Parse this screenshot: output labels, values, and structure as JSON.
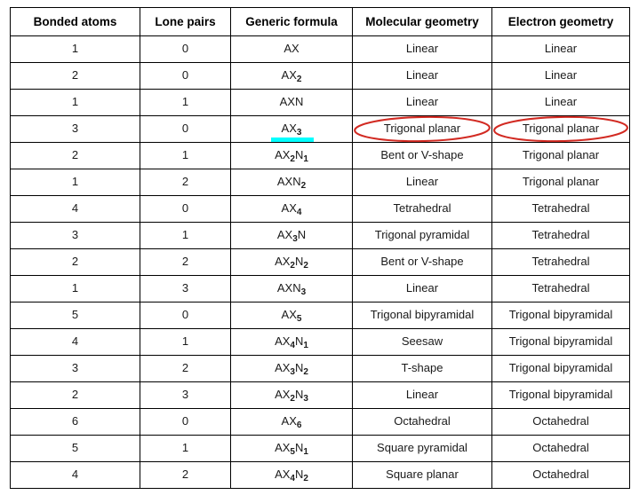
{
  "table": {
    "headers": [
      "Bonded atoms",
      "Lone pairs",
      "Generic formula",
      "Molecular geometry",
      "Electron geometry"
    ],
    "rows": [
      {
        "bonded_atoms": "1",
        "lone_pairs": "0",
        "formula_base": "AX",
        "formula_sub1": "",
        "formula_mid": "",
        "formula_sub2": "",
        "formula_plain": "AX",
        "molecular_geometry": "Linear",
        "electron_geometry": "Linear"
      },
      {
        "bonded_atoms": "2",
        "lone_pairs": "0",
        "formula_base": "AX",
        "formula_sub1": "2",
        "formula_mid": "",
        "formula_sub2": "",
        "formula_plain": "AX2",
        "molecular_geometry": "Linear",
        "electron_geometry": "Linear"
      },
      {
        "bonded_atoms": "1",
        "lone_pairs": "1",
        "formula_base": "AX",
        "formula_sub1": "",
        "formula_mid": "N",
        "formula_sub2": "",
        "formula_plain": "AXN",
        "molecular_geometry": "Linear",
        "electron_geometry": "Linear"
      },
      {
        "bonded_atoms": "3",
        "lone_pairs": "0",
        "formula_base": "AX",
        "formula_sub1": "3",
        "formula_mid": "",
        "formula_sub2": "",
        "formula_plain": "AX3",
        "molecular_geometry": "Trigonal planar",
        "electron_geometry": "Trigonal planar"
      },
      {
        "bonded_atoms": "2",
        "lone_pairs": "1",
        "formula_base": "AX",
        "formula_sub1": "2",
        "formula_mid": "N",
        "formula_sub2": "1",
        "formula_plain": "AX2N1",
        "molecular_geometry": "Bent or V-shape",
        "electron_geometry": "Trigonal planar"
      },
      {
        "bonded_atoms": "1",
        "lone_pairs": "2",
        "formula_base": "AX",
        "formula_sub1": "",
        "formula_mid": "N",
        "formula_sub2": "2",
        "formula_plain": "AXN2",
        "molecular_geometry": "Linear",
        "electron_geometry": "Trigonal planar"
      },
      {
        "bonded_atoms": "4",
        "lone_pairs": "0",
        "formula_base": "AX",
        "formula_sub1": "4",
        "formula_mid": "",
        "formula_sub2": "",
        "formula_plain": "AX4",
        "molecular_geometry": "Tetrahedral",
        "electron_geometry": "Tetrahedral"
      },
      {
        "bonded_atoms": "3",
        "lone_pairs": "1",
        "formula_base": "AX",
        "formula_sub1": "3",
        "formula_mid": "N",
        "formula_sub2": "",
        "formula_plain": "AX3N",
        "molecular_geometry": "Trigonal pyramidal",
        "electron_geometry": "Tetrahedral"
      },
      {
        "bonded_atoms": "2",
        "lone_pairs": "2",
        "formula_base": "AX",
        "formula_sub1": "2",
        "formula_mid": "N",
        "formula_sub2": "2",
        "formula_plain": "AX2N2",
        "molecular_geometry": "Bent or V-shape",
        "electron_geometry": "Tetrahedral"
      },
      {
        "bonded_atoms": "1",
        "lone_pairs": "3",
        "formula_base": "AX",
        "formula_sub1": "",
        "formula_mid": "N",
        "formula_sub2": "3",
        "formula_plain": "AXN3",
        "molecular_geometry": "Linear",
        "electron_geometry": "Tetrahedral"
      },
      {
        "bonded_atoms": "5",
        "lone_pairs": "0",
        "formula_base": "AX",
        "formula_sub1": "5",
        "formula_mid": "",
        "formula_sub2": "",
        "formula_plain": "AX5",
        "molecular_geometry": "Trigonal bipyramidal",
        "electron_geometry": "Trigonal bipyramidal"
      },
      {
        "bonded_atoms": "4",
        "lone_pairs": "1",
        "formula_base": "AX",
        "formula_sub1": "4",
        "formula_mid": "N",
        "formula_sub2": "1",
        "formula_plain": "AX4N1",
        "molecular_geometry": "Seesaw",
        "electron_geometry": "Trigonal bipyramidal"
      },
      {
        "bonded_atoms": "3",
        "lone_pairs": "2",
        "formula_base": "AX",
        "formula_sub1": "3",
        "formula_mid": "N",
        "formula_sub2": "2",
        "formula_plain": "AX3N2",
        "molecular_geometry": "T-shape",
        "electron_geometry": "Trigonal bipyramidal"
      },
      {
        "bonded_atoms": "2",
        "lone_pairs": "3",
        "formula_base": "AX",
        "formula_sub1": "2",
        "formula_mid": "N",
        "formula_sub2": "3",
        "formula_plain": "AX2N3",
        "molecular_geometry": "Linear",
        "electron_geometry": "Trigonal bipyramidal"
      },
      {
        "bonded_atoms": "6",
        "lone_pairs": "0",
        "formula_base": "AX",
        "formula_sub1": "6",
        "formula_mid": "",
        "formula_sub2": "",
        "formula_plain": "AX6",
        "molecular_geometry": "Octahedral",
        "electron_geometry": "Octahedral"
      },
      {
        "bonded_atoms": "5",
        "lone_pairs": "1",
        "formula_base": "AX",
        "formula_sub1": "5",
        "formula_mid": "N",
        "formula_sub2": "1",
        "formula_plain": "AX5N1",
        "molecular_geometry": "Square pyramidal",
        "electron_geometry": "Octahedral"
      },
      {
        "bonded_atoms": "4",
        "lone_pairs": "2",
        "formula_base": "AX",
        "formula_sub1": "4",
        "formula_mid": "N",
        "formula_sub2": "2",
        "formula_plain": "AX4N2",
        "molecular_geometry": "Square planar",
        "electron_geometry": "Octahedral"
      }
    ]
  },
  "annotations": {
    "highlighted_row_index": 3,
    "highlight_underline_color": "#00ffff",
    "highlight_underline_target": "AX3",
    "ellipse_color": "#d22a22",
    "ellipse_targets": [
      "Trigonal planar",
      "Trigonal planar"
    ]
  },
  "colors": {
    "formula_text": "#ff0000",
    "body_text": "#1a1a1a",
    "header_text": "#000000",
    "border": "#000000",
    "background": "#ffffff"
  }
}
